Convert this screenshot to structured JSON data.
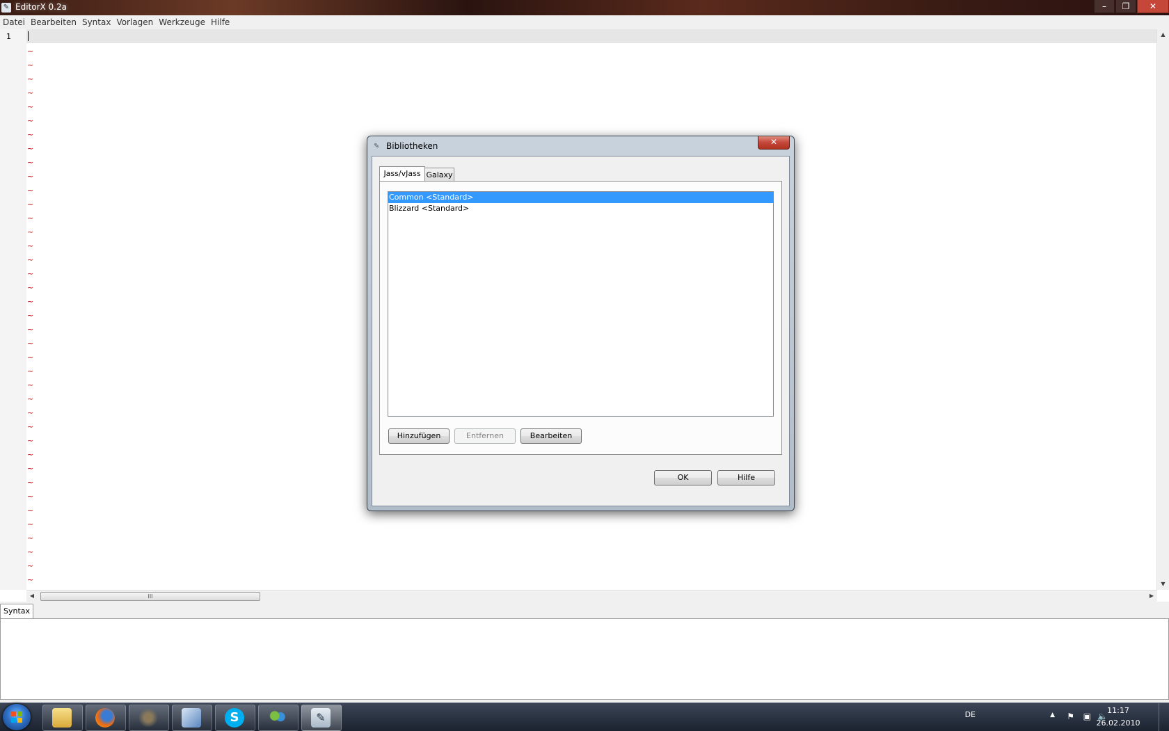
{
  "window": {
    "title": "EditorX 0.2a",
    "controls": {
      "minimize": "–",
      "maximize": "❐",
      "close": "✕"
    }
  },
  "menu": [
    "Datei",
    "Bearbeiten",
    "Syntax",
    "Vorlagen",
    "Werkzeuge",
    "Hilfe"
  ],
  "editor": {
    "line_number": "1",
    "empty_line_marker": "~",
    "scroll_thumb_grip": "III"
  },
  "bottom_panel": {
    "tab_label": "Syntax"
  },
  "dialog": {
    "title": "Bibliotheken",
    "close_label": "✕",
    "tabs": [
      "Jass/vJass",
      "Galaxy"
    ],
    "active_tab": "Jass/vJass",
    "libraries": [
      "Common <Standard>",
      "Blizzard <Standard>"
    ],
    "selected_library": "Common <Standard>",
    "buttons": {
      "add": "Hinzufügen",
      "remove": "Entfernen",
      "edit": "Bearbeiten",
      "ok": "OK",
      "help": "Hilfe"
    }
  },
  "taskbar": {
    "language": "DE",
    "time": "11:17",
    "date": "26.02.2010"
  },
  "colors": {
    "selection": "#3399ff",
    "tilde": "#c00000",
    "close_button": "#c4473a"
  }
}
